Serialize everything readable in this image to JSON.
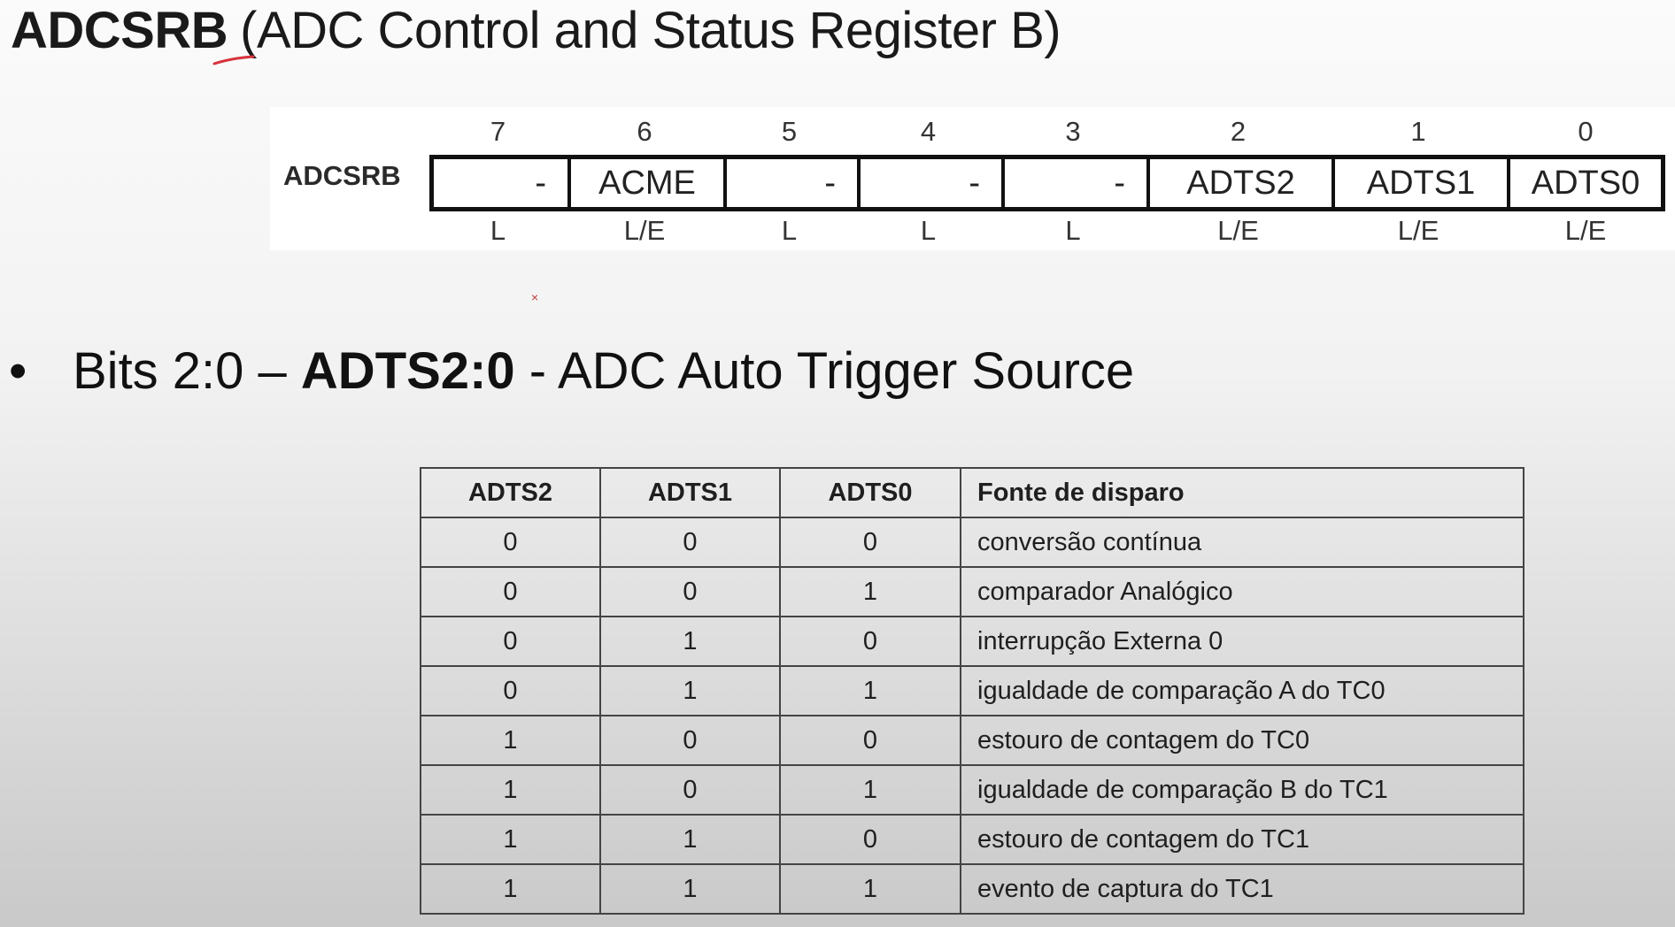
{
  "title": {
    "bold": "ADCSRB",
    "rest": "(ADC Control and Status Register B)"
  },
  "register": {
    "name": "ADCSRB",
    "bits": [
      {
        "num": "7",
        "name": "-",
        "access": "L"
      },
      {
        "num": "6",
        "name": "ACME",
        "access": "L/E"
      },
      {
        "num": "5",
        "name": "-",
        "access": "L"
      },
      {
        "num": "4",
        "name": "-",
        "access": "L"
      },
      {
        "num": "3",
        "name": "-",
        "access": "L"
      },
      {
        "num": "2",
        "name": "ADTS2",
        "access": "L/E"
      },
      {
        "num": "1",
        "name": "ADTS1",
        "access": "L/E"
      },
      {
        "num": "0",
        "name": "ADTS0",
        "access": "L/E"
      }
    ]
  },
  "bullet": {
    "prefix": "Bits 2:0 – ",
    "bold": "ADTS2:0",
    "suffix": " - ADC Auto Trigger Source"
  },
  "table": {
    "headers": [
      "ADTS2",
      "ADTS1",
      "ADTS0",
      "Fonte de disparo"
    ],
    "rows": [
      [
        "0",
        "0",
        "0",
        "conversão contínua"
      ],
      [
        "0",
        "0",
        "1",
        "comparador Analógico"
      ],
      [
        "0",
        "1",
        "0",
        "interrupção Externa 0"
      ],
      [
        "0",
        "1",
        "1",
        "igualdade de comparação A do TC0"
      ],
      [
        "1",
        "0",
        "0",
        "estouro de contagem do TC0"
      ],
      [
        "1",
        "0",
        "1",
        "igualdade de comparação B do TC1"
      ],
      [
        "1",
        "1",
        "0",
        "estouro de contagem do TC1"
      ],
      [
        "1",
        "1",
        "1",
        "evento de captura do TC1"
      ]
    ]
  },
  "colors": {
    "underline": "#d8323c"
  }
}
